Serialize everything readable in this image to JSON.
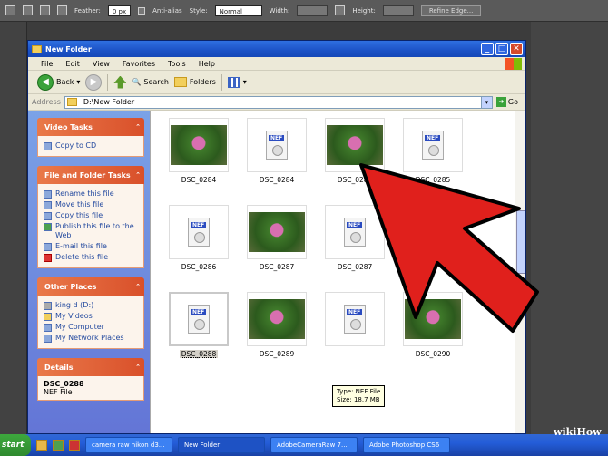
{
  "ps": {
    "feather_label": "Feather:",
    "feather_value": "0 px",
    "antialias_label": "Anti-alias",
    "style_label": "Style:",
    "style_value": "Normal",
    "width_label": "Width:",
    "height_label": "Height:",
    "refine_label": "Refine Edge..."
  },
  "window": {
    "title": "New Folder",
    "menu": [
      "File",
      "Edit",
      "View",
      "Favorites",
      "Tools",
      "Help"
    ],
    "toolbar": {
      "back": "Back",
      "search": "Search",
      "folders": "Folders"
    },
    "address_label": "Address",
    "address_value": "D:\\New Folder",
    "go_label": "Go"
  },
  "taskpane": {
    "video": {
      "title": "Video Tasks",
      "items": [
        "Copy to CD"
      ]
    },
    "file_folder": {
      "title": "File and Folder Tasks",
      "items": [
        "Rename this file",
        "Move this file",
        "Copy this file",
        "Publish this file to the Web",
        "E-mail this file",
        "Delete this file"
      ]
    },
    "other": {
      "title": "Other Places",
      "items": [
        "king d (D:)",
        "My Videos",
        "My Computer",
        "My Network Places"
      ]
    },
    "details": {
      "title": "Details",
      "name": "DSC_0288",
      "type": "NEF File"
    }
  },
  "files": [
    {
      "name": "DSC_0284",
      "kind": "photo"
    },
    {
      "name": "DSC_0284",
      "kind": "nef"
    },
    {
      "name": "DSC_0285",
      "kind": "photo"
    },
    {
      "name": "DSC_0285",
      "kind": "nef"
    },
    {
      "name": "DSC_0286",
      "kind": "nef"
    },
    {
      "name": "DSC_0287",
      "kind": "photo"
    },
    {
      "name": "DSC_0287",
      "kind": "nef"
    },
    {
      "name": "",
      "kind": "empty"
    },
    {
      "name": "DSC_0288",
      "kind": "nef",
      "selected": true
    },
    {
      "name": "DSC_0289",
      "kind": "photo"
    },
    {
      "name": "",
      "kind": "nef"
    },
    {
      "name": "DSC_0290",
      "kind": "photo"
    }
  ],
  "tooltip": {
    "line1": "Type: NEF File",
    "line2": "Size: 18.7 MB"
  },
  "taskbar": {
    "start": "start",
    "items": [
      "camera raw nikon d3...",
      "New Folder",
      "AdobeCameraRaw 7...",
      "Adobe Photoshop CS6"
    ]
  },
  "watermark": "wikiHow",
  "colors": {
    "xp_blue": "#245dd8",
    "task_orange": "#d9502a",
    "arrow_red": "#e0201c"
  }
}
